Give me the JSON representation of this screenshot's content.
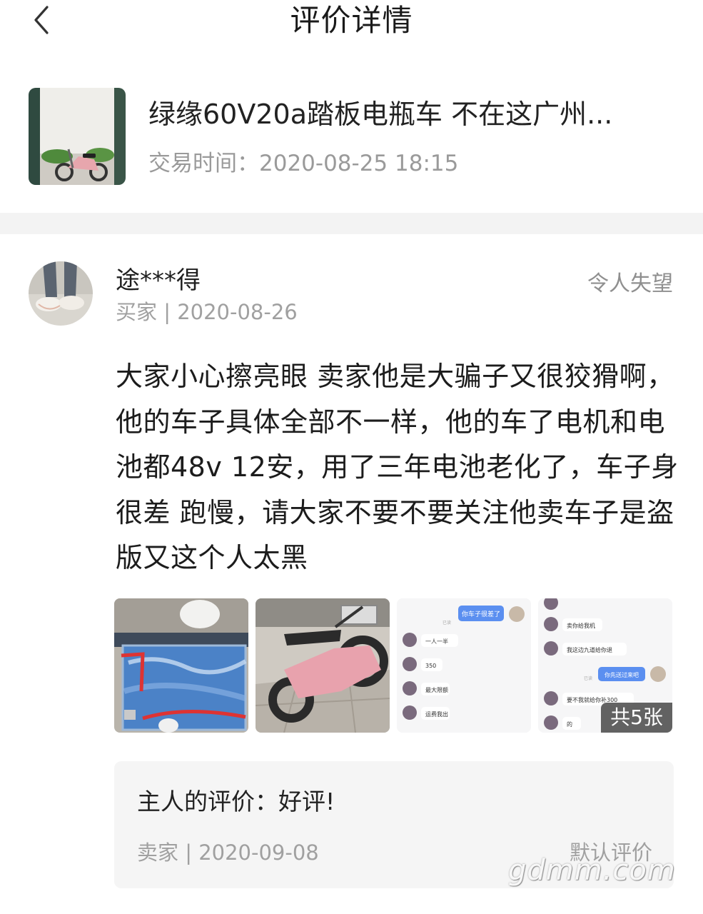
{
  "header": {
    "title": "评价详情",
    "back_icon": "chevron-left-icon"
  },
  "product": {
    "title": "绿缘60V20a踏板电瓶车 不在这广州...",
    "time": "交易时间：2020-08-25 18:15"
  },
  "review": {
    "user": "途***得",
    "meta": "买家 | 2020-08-26",
    "rating": "令人失望",
    "text": "大家小心擦亮眼 卖家他是大骗子又很狡猾啊，他的车子具体全部不一样，他的车了电机和电池都48v  12安，用了三年电池老化了，车子身很差 跑慢，请大家不要不要关注他卖车子是盗版又这个人太黑",
    "photo_count": "共5张",
    "chat1": {
      "bubble": "你车子很差了",
      "left": [
        "一人一半",
        "350",
        "最大限额",
        "运费我出"
      ],
      "tiny": "已读"
    },
    "chat2": {
      "left": [
        "卖你给我机",
        "我这边九道给你退"
      ],
      "bubble": "你先送过来吧",
      "left2": [
        "要不我就给你补300",
        "的"
      ],
      "tiny": "已读"
    }
  },
  "reply": {
    "text": "主人的评价：好评!",
    "meta": "卖家 | 2020-09-08",
    "tag": "默认评价"
  },
  "watermark": "gdmm.com"
}
